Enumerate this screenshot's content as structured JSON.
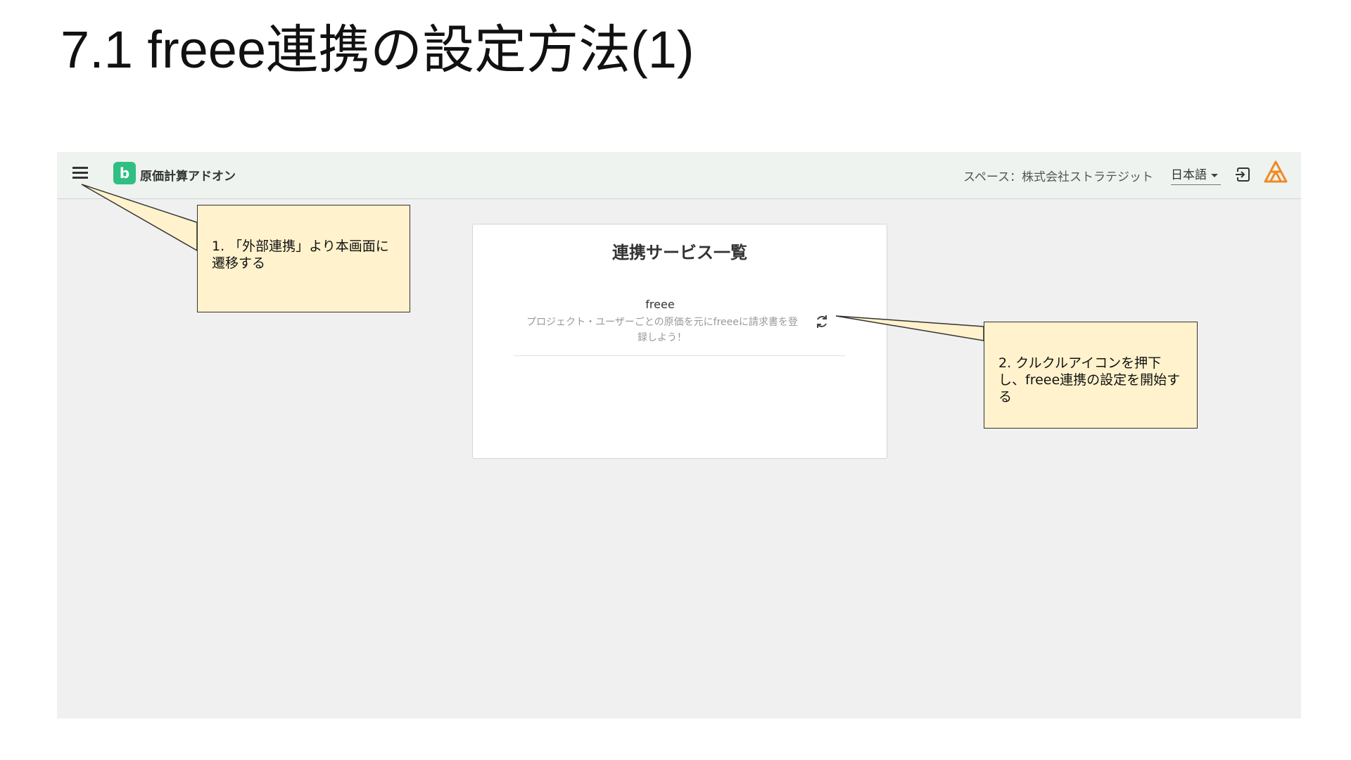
{
  "slide": {
    "title": "7.1 freee連携の設定方法(1)"
  },
  "appbar": {
    "logo_letter": "b",
    "app_name": "原価計算アドオン",
    "space_label": "スペース：株式会社ストラテジット",
    "language": "日本語",
    "icons": [
      "menu-icon",
      "logout-icon",
      "brand-icon"
    ]
  },
  "card": {
    "title": "連携サービス一覧",
    "service": {
      "name": "freee",
      "description": "プロジェクト・ユーザーごとの原価を元にfreeeに請求書を登録しよう！",
      "action_icon": "sync-icon"
    }
  },
  "callouts": [
    {
      "text": "1. 「外部連携」より本画面に遷移する"
    },
    {
      "text": "2. クルクルアイコンを押下し、freee連携の設定を開始する"
    }
  ],
  "colors": {
    "appbar_bg": "#eef3ef",
    "logo_green": "#2fbf83",
    "brand_orange": "#f08a24",
    "callout_bg": "#fff2cc",
    "screen_bg": "#f0f0f0"
  }
}
